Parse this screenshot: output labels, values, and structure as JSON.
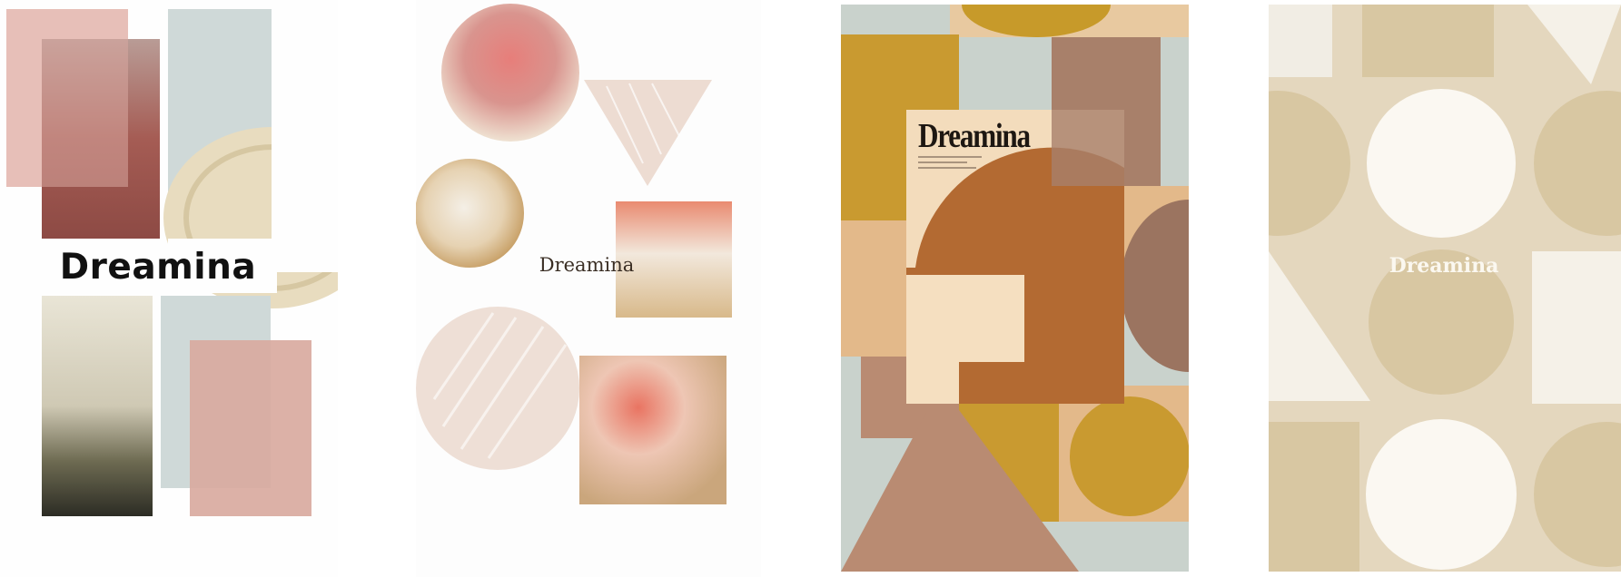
{
  "panels": [
    {
      "title": "Dreamina"
    },
    {
      "title": "Dreamina"
    },
    {
      "title": "Dreamina"
    },
    {
      "title": "Dreamina"
    }
  ]
}
